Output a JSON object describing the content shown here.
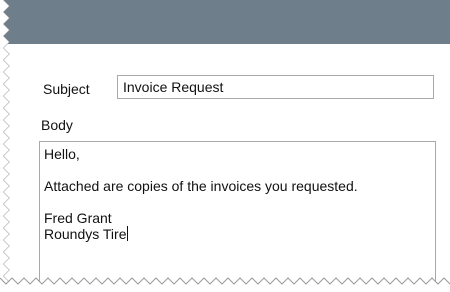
{
  "form": {
    "subject_label": "Subject",
    "subject_value": "Invoice Request",
    "body_label": "Body",
    "body_lines": [
      "Hello,",
      "",
      "Attached are copies of the invoices you requested.",
      "",
      "Fred Grant",
      "Roundys Tire"
    ]
  },
  "colors": {
    "title_bar": "#6f7e8b",
    "field_border": "#a9a9a9"
  }
}
